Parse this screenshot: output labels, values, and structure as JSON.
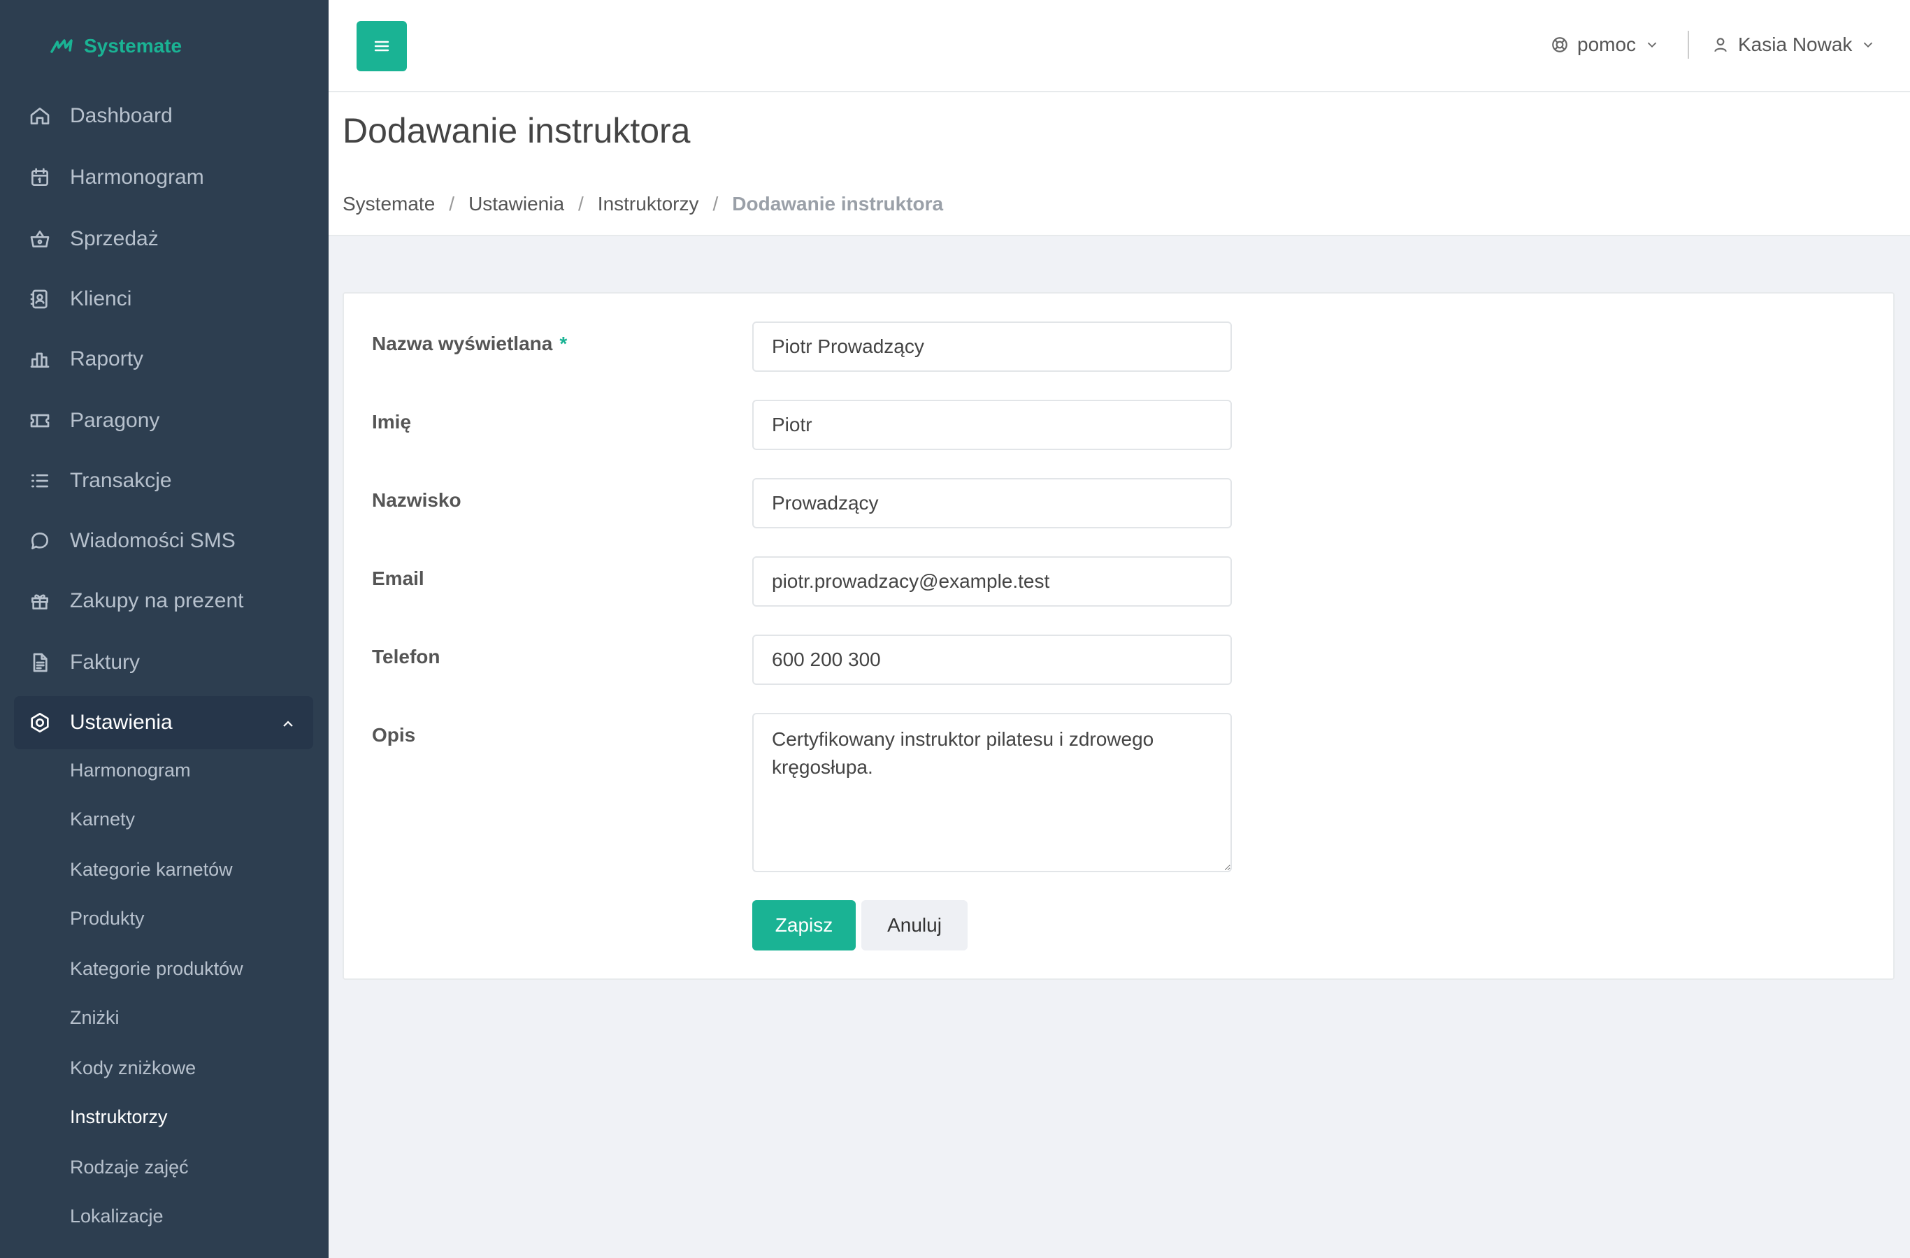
{
  "brand": {
    "name": "Systemate",
    "color": "#1ab394"
  },
  "sidebar": {
    "items": [
      {
        "label": "Dashboard",
        "icon": "home-icon"
      },
      {
        "label": "Harmonogram",
        "icon": "calendar-icon"
      },
      {
        "label": "Sprzedaż",
        "icon": "basket-icon"
      },
      {
        "label": "Klienci",
        "icon": "contacts-book-icon"
      },
      {
        "label": "Raporty",
        "icon": "bar-chart-icon"
      },
      {
        "label": "Paragony",
        "icon": "ticket-icon"
      },
      {
        "label": "Transakcje",
        "icon": "list-icon"
      },
      {
        "label": "Wiadomości SMS",
        "icon": "chat-bubble-icon"
      },
      {
        "label": "Zakupy na prezent",
        "icon": "gift-icon"
      },
      {
        "label": "Faktury",
        "icon": "document-icon"
      },
      {
        "label": "Ustawienia",
        "icon": "settings-icon"
      }
    ],
    "sub_items": [
      "Harmonogram",
      "Karnety",
      "Kategorie karnetów",
      "Produkty",
      "Kategorie produktów",
      "Zniżki",
      "Kody zniżkowe",
      "Instruktorzy",
      "Rodzaje zajęć",
      "Lokalizacje"
    ]
  },
  "header": {
    "menu_icon": "hamburger-icon",
    "help_label": "pomoc",
    "user_name": "Kasia Nowak"
  },
  "page": {
    "title": "Dodawanie instruktora",
    "breadcrumb": [
      "Systemate",
      "Ustawienia",
      "Instruktorzy",
      "Dodawanie instruktora"
    ]
  },
  "form": {
    "display_name": {
      "label": "Nazwa wyświetlana",
      "required_mark": "*",
      "value": "Piotr Prowadzący"
    },
    "first_name": {
      "label": "Imię",
      "value": "Piotr"
    },
    "last_name": {
      "label": "Nazwisko",
      "value": "Prowadzący"
    },
    "email": {
      "label": "Email",
      "value": "piotr.prowadzacy@example.test"
    },
    "phone": {
      "label": "Telefon",
      "value": "600 200 300"
    },
    "description": {
      "label": "Opis",
      "value": "Certyfikowany instruktor pilatesu i zdrowego kręgosłupa."
    },
    "save_label": "Zapisz",
    "cancel_label": "Anuluj"
  }
}
